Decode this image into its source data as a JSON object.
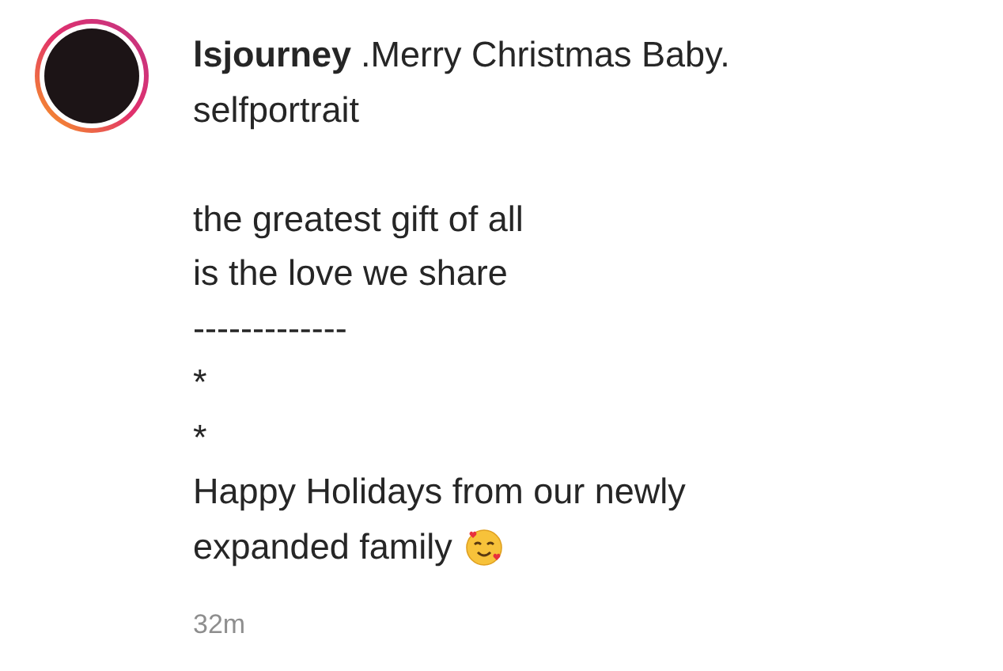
{
  "post": {
    "username": "lsjourney",
    "caption_lines": [
      ".Merry Christmas Baby.",
      "selfportrait"
    ],
    "message_lines": [
      "the greatest gift of all",
      "is the love we share",
      "-------------",
      "*",
      "*",
      "Happy Holidays from our newly",
      "expanded family"
    ],
    "time": "32m"
  }
}
